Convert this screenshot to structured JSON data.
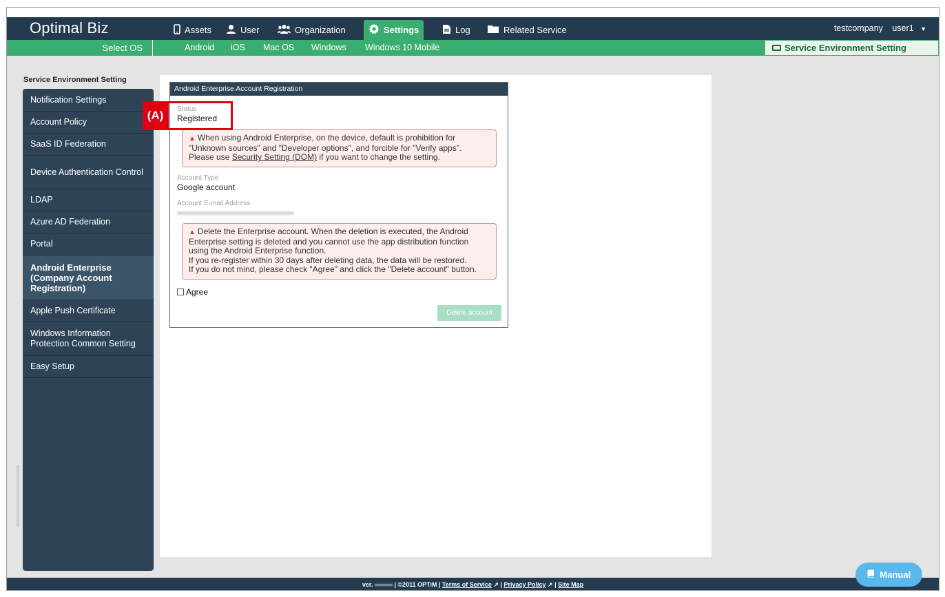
{
  "app": {
    "brand": "Optimal Biz"
  },
  "top_nav": [
    {
      "label": "Assets",
      "icon": "phone-icon",
      "active": false
    },
    {
      "label": "User",
      "icon": "user-icon",
      "active": false
    },
    {
      "label": "Organization",
      "icon": "group-icon",
      "active": false
    },
    {
      "label": "Settings",
      "icon": "gear-icon",
      "active": true
    },
    {
      "label": "Log",
      "icon": "document-icon",
      "active": false
    },
    {
      "label": "Related Service",
      "icon": "folder-icon",
      "active": false
    }
  ],
  "user_area": {
    "company": "testcompany",
    "user": "user1",
    "caret": "▼"
  },
  "sub_nav": {
    "select_os": "Select OS",
    "os_items": [
      "Android",
      "iOS",
      "Mac OS",
      "Windows",
      "Windows 10 Mobile"
    ],
    "service_env": "Service Environment Setting"
  },
  "sidebar": {
    "heading": "Service Environment Setting",
    "items": [
      {
        "label": "Notification Settings"
      },
      {
        "label": "Account Policy"
      },
      {
        "label": "SaaS ID Federation"
      },
      {
        "label": "Device Authentication Control"
      },
      {
        "label": "LDAP"
      },
      {
        "label": "Azure AD Federation"
      },
      {
        "label": "Portal"
      },
      {
        "label": "Android Enterprise (Company Account Registration)"
      },
      {
        "label": "Apple Push Certificate"
      },
      {
        "label": "Windows Information Protection Common Setting"
      },
      {
        "label": "Easy Setup"
      }
    ],
    "active_index": 7
  },
  "panel": {
    "title": "Android Enterprise Account Registration",
    "status_label": "Status",
    "status_value": "Registered",
    "warning1": {
      "line1": "When using Android Enterprise, on the device, default is prohibition for",
      "line2": "\"Unknown sources\" and \"Developer options\", and forcible for \"Verify apps\".",
      "line3_pre": "Please use ",
      "line3_link": "Security Setting (DOM)",
      "line3_post": " if you want to change the setting."
    },
    "account_type_label": "Account Type",
    "account_type_value": "Google account",
    "email_label": "Account E-mail Address",
    "warning2": {
      "line1": "Delete the Enterprise account. When the deletion is executed, the Android",
      "line2": "Enterprise setting is deleted and you cannot use the app distribution function",
      "line3": "using the Android Enterprise function.",
      "line4": "If you re-register within 30 days after deleting data, the data will be restored.",
      "line5": "If you do not mind, please check \"Agree\" and click the \"Delete account\" button."
    },
    "agree_label": "Agree",
    "agree_checked": false,
    "delete_button": "Delete account"
  },
  "annotation": {
    "marker": "(A)"
  },
  "footer": {
    "ver": "ver.",
    "copyright": "| ©2011 OPTiM |",
    "terms": "Terms of Service",
    "privacy": "Privacy Policy",
    "sitemap": "Site Map",
    "sep": "|"
  },
  "manual_button": "Manual",
  "colors": {
    "header_bg": "#243a4e",
    "accent_green": "#3aae71",
    "sidebar_bg": "#2e4456",
    "warning_border": "#e08a86",
    "warning_bg": "#fdeeed",
    "annotation_red": "#e00010",
    "manual_blue": "#5bb8ec"
  }
}
